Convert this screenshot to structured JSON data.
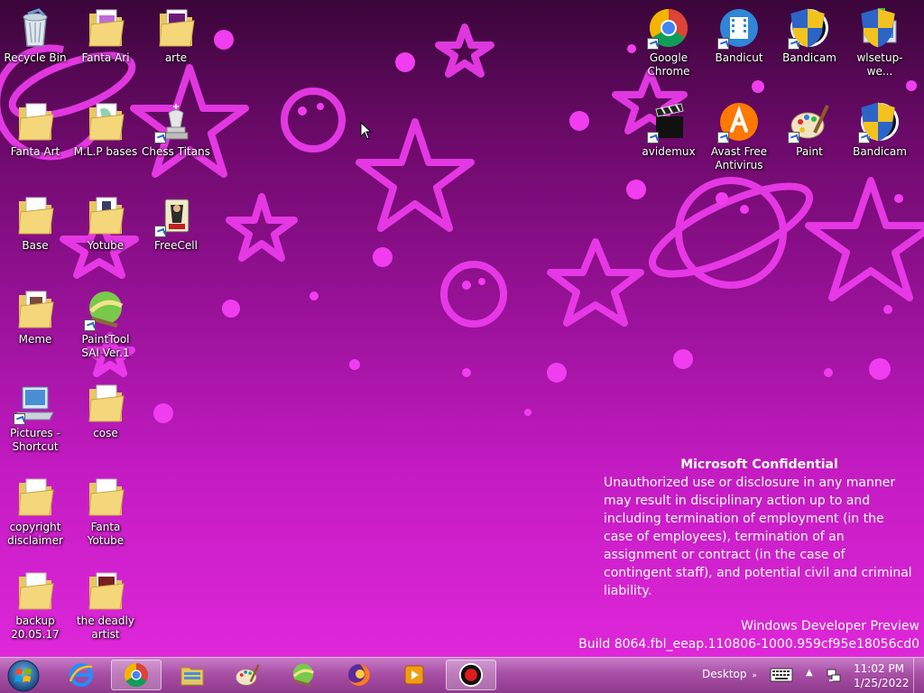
{
  "desktop_icons_left": [
    {
      "label": "Recycle Bin",
      "icon": "recycle-bin-icon"
    },
    {
      "label": "Fanta Ari",
      "icon": "folder-icon"
    },
    {
      "label": "arte",
      "icon": "folder-icon"
    },
    {
      "label": "Fanta Art",
      "icon": "folder-icon"
    },
    {
      "label": "M.L.P bases",
      "icon": "folder-icon"
    },
    {
      "label": "Chess Titans",
      "icon": "chess-icon"
    },
    {
      "label": "Base",
      "icon": "folder-icon"
    },
    {
      "label": "Yotube",
      "icon": "folder-icon"
    },
    {
      "label": "FreeCell",
      "icon": "freecell-icon"
    },
    {
      "label": "Meme",
      "icon": "folder-icon"
    },
    {
      "label": "PaintTool SAI Ver.1",
      "icon": "painttool-sai-icon"
    },
    {
      "label": "Pictures - Shortcut",
      "icon": "pictures-shortcut-icon"
    },
    {
      "label": "cose",
      "icon": "folder-icon"
    },
    {
      "label": "copyright disclaimer",
      "icon": "folder-icon"
    },
    {
      "label": "Fanta Yotube",
      "icon": "folder-icon"
    },
    {
      "label": "backup 20.05.17",
      "icon": "folder-icon"
    },
    {
      "label": "the deadly artist",
      "icon": "folder-icon"
    }
  ],
  "desktop_icons_right": [
    {
      "label": "Google Chrome",
      "icon": "chrome-icon"
    },
    {
      "label": "Bandicut",
      "icon": "bandicut-icon"
    },
    {
      "label": "Bandicam",
      "icon": "bandicam-icon"
    },
    {
      "label": "wlsetup-we...",
      "icon": "installer-icon"
    },
    {
      "label": "avidemux",
      "icon": "avidemux-icon"
    },
    {
      "label": "Avast Free Antivirus",
      "icon": "avast-icon"
    },
    {
      "label": "Paint",
      "icon": "paint-icon"
    },
    {
      "label": "Bandicam",
      "icon": "bandicam-icon"
    }
  ],
  "watermark": {
    "title": "Microsoft Confidential",
    "body": "Unauthorized use or disclosure in any manner may result in disciplinary action up to and including termination of employment (in the case of employees), termination of an assignment or contract (in the case of contingent staff), and potential civil and criminal liability.",
    "build_name": "Windows Developer Preview",
    "build_number": "Build 8064.fbl_eeap.110806-1000.959cf95e18056cd0"
  },
  "taskbar": {
    "pinned": [
      {
        "name": "internet-explorer",
        "icon": "internet-explorer-icon"
      },
      {
        "name": "google-chrome",
        "icon": "chrome-icon"
      },
      {
        "name": "file-explorer",
        "icon": "file-explorer-icon"
      },
      {
        "name": "paint",
        "icon": "paint-icon"
      },
      {
        "name": "painttool-sai",
        "icon": "painttool-sai-icon"
      },
      {
        "name": "firefox",
        "icon": "firefox-icon"
      },
      {
        "name": "media-player",
        "icon": "media-player-icon"
      },
      {
        "name": "bandicam",
        "icon": "bandicam-icon"
      }
    ],
    "desktop_label": "Desktop",
    "clock_time": "11:02 PM",
    "clock_date": "1/25/2022"
  },
  "colors": {
    "taskbar": "#a84fa6",
    "wallpaper_top": "#3a0639",
    "wallpaper_bottom": "#de27d9",
    "wallpaper_shapes": "#f13cf0"
  }
}
